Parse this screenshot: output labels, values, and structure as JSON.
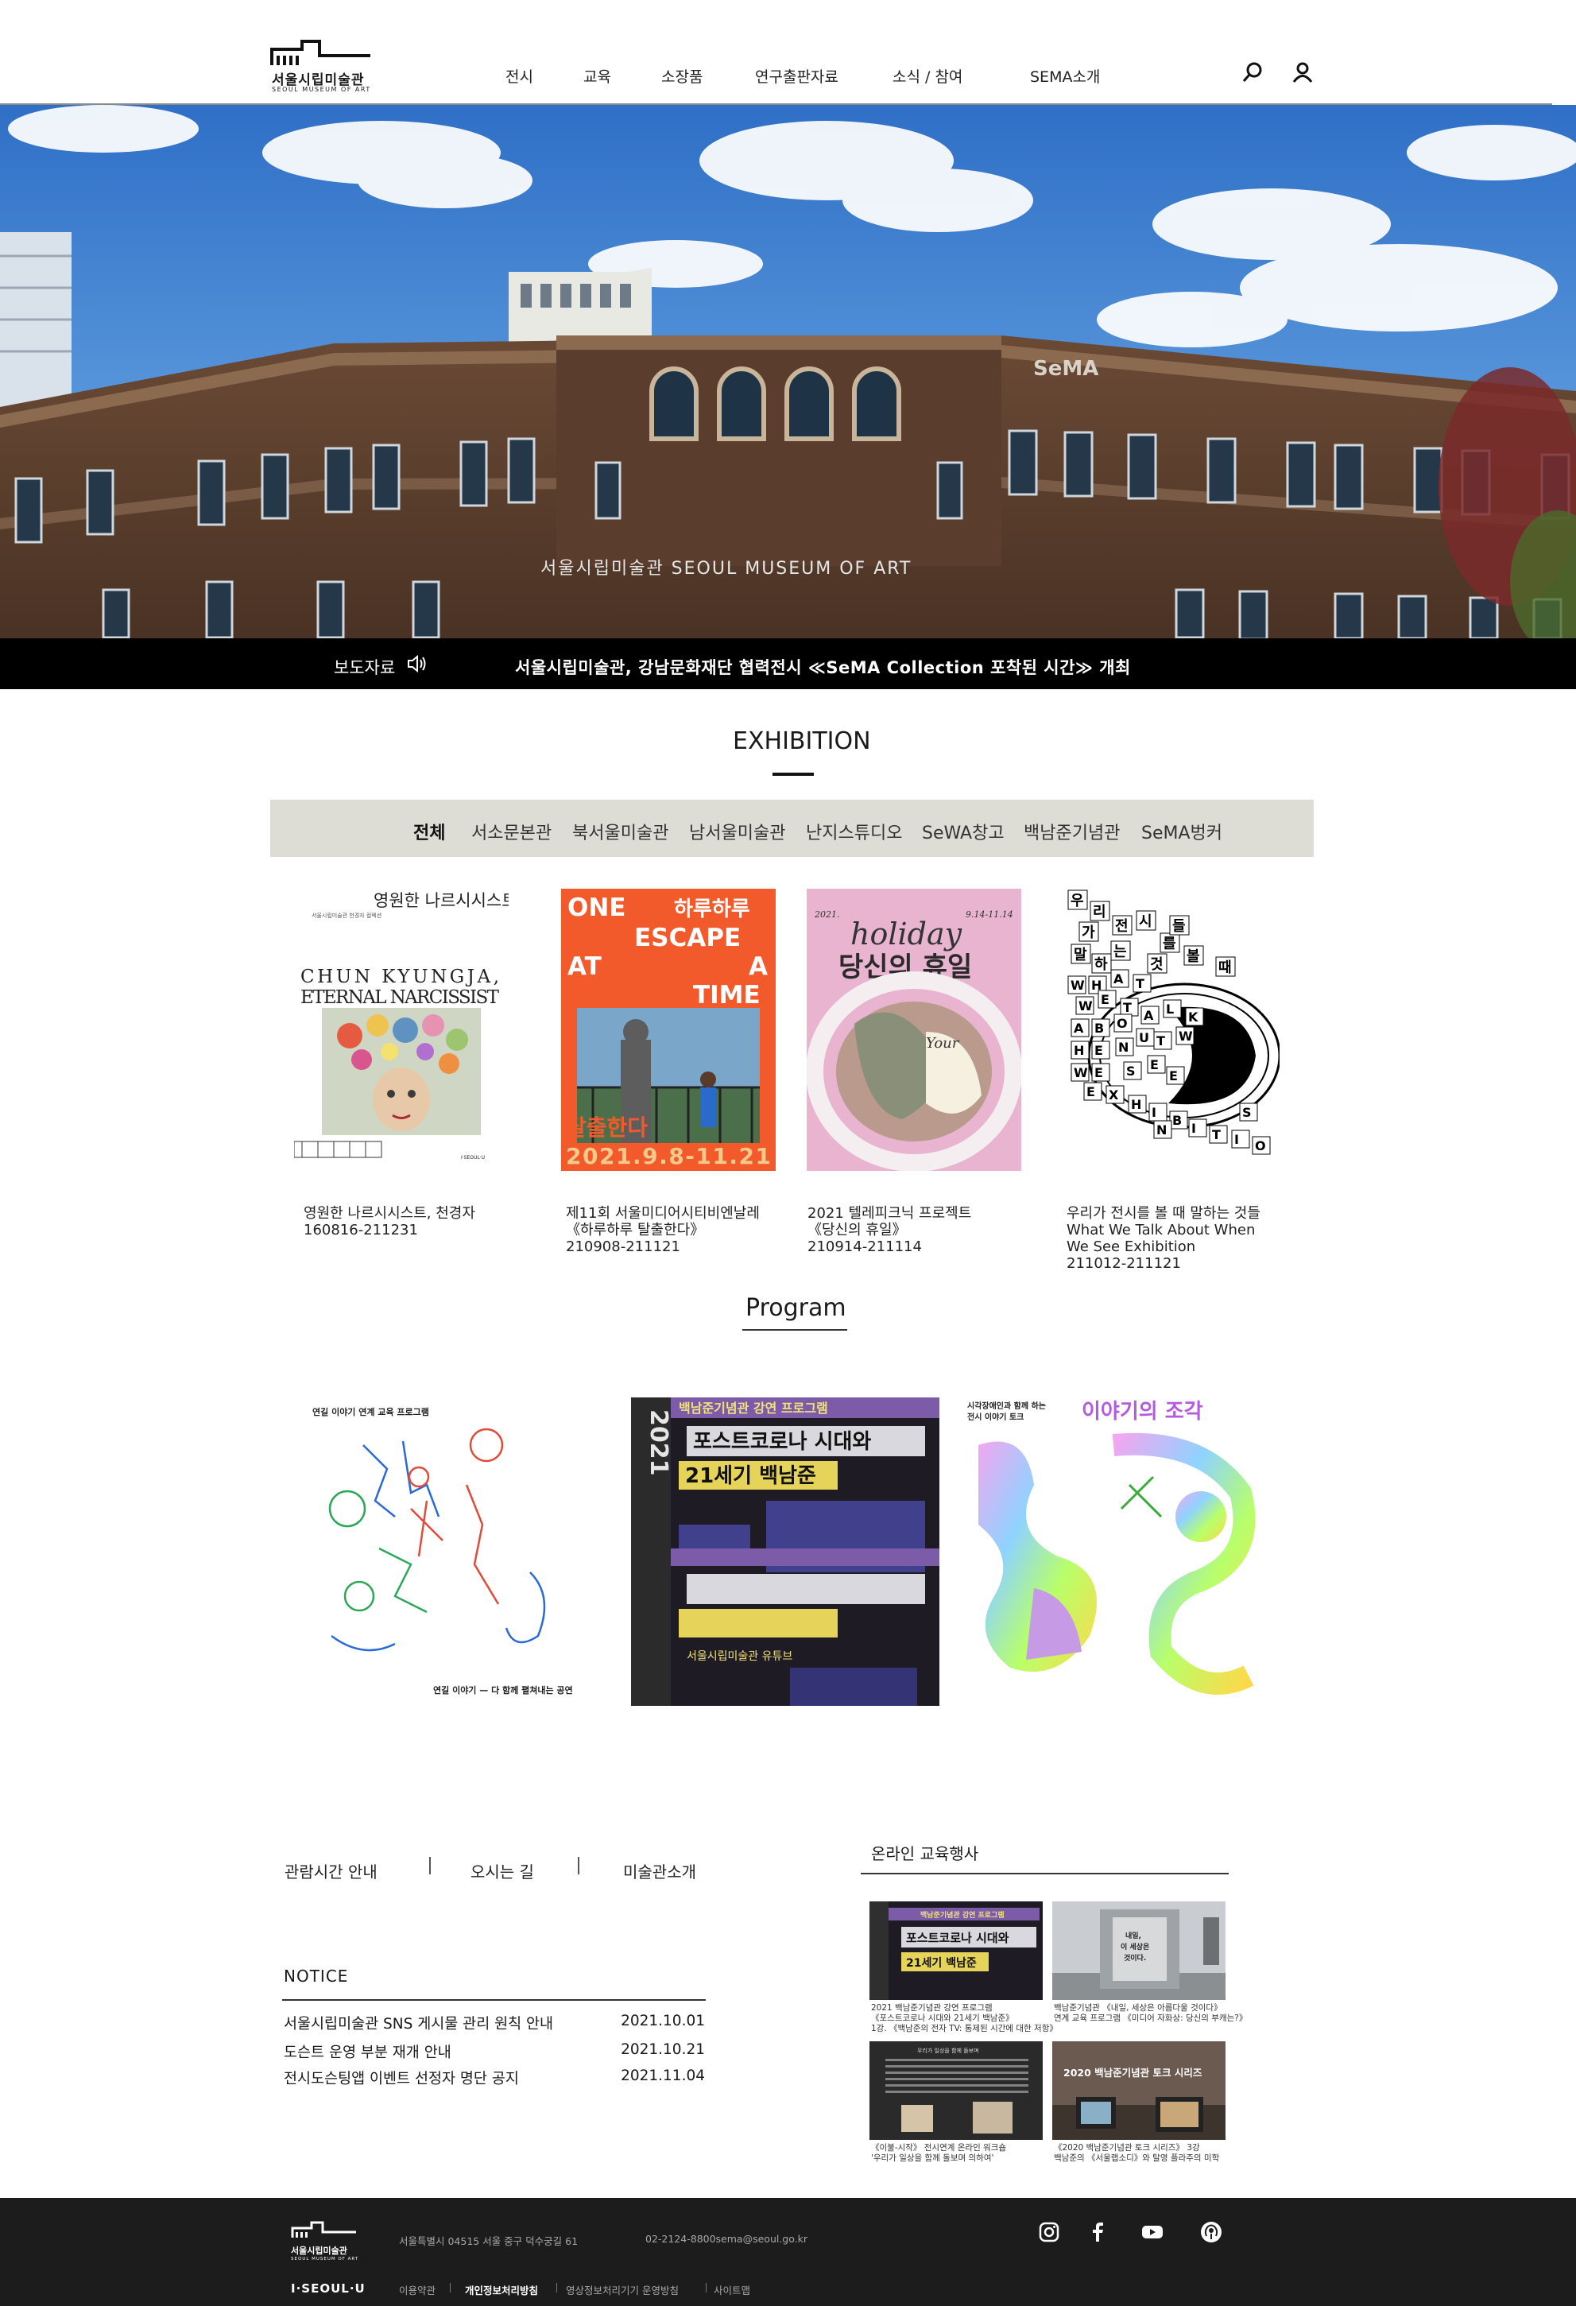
{
  "header": {
    "logo_ko": "서울시립미술관",
    "logo_en": "SEOUL MUSEUM OF ART",
    "nav": [
      "전시",
      "교육",
      "소장품",
      "연구출판자료",
      "소식 / 참여",
      "SEMA소개"
    ],
    "icons": [
      "search-icon",
      "user-icon"
    ]
  },
  "hero": {
    "sign_top": "SeMA",
    "sign_facade": "서울시립미술관 SEOUL MUSEUM OF ART"
  },
  "press": {
    "label": "보도자료",
    "text": "서울시립미술관, 강남문화재단 협력전시 ≪SeMA Collection 포착된 시간≫ 개최"
  },
  "exhibition": {
    "title": "EXHIBITION",
    "tabs": [
      "전체",
      "서소문본관",
      "북서울미술관",
      "남서울미술관",
      "난지스튜디오",
      "SeWA창고",
      "백남준기념관",
      "SeMA벙커"
    ],
    "items": [
      {
        "poster": {
          "small": "서울시립미술관 천경자 컬렉션",
          "title_ko": "영원한 나르시시스트, 천경자",
          "title_en_1": "CHUN KYUNGJA,",
          "title_en_2": "ETERNAL NARCISSIST",
          "logo": "I·SEOUL·U"
        },
        "caption": [
          "영원한 나르시시스트, 천경자",
          "160816-211231"
        ]
      },
      {
        "poster": {
          "word1": "ONE",
          "word2": "하루하루",
          "word3": "ESCAPE",
          "word4": "AT",
          "word5": "A",
          "word6": "TIME",
          "word7": "탈출한다",
          "dates": "2021.9.8-11.21"
        },
        "caption": [
          "제11회 서울미디어시티비엔날레",
          "《하루하루 탈출한다》",
          "210908-211121"
        ]
      },
      {
        "poster": {
          "year": "2021.",
          "range": "9.14-11.14",
          "title_en": "holiday",
          "title_ko": "당신의 휴일",
          "title_en2": "Your"
        },
        "caption": [
          "2021 텔레피크닉 프로젝트",
          "《당신의 휴일》",
          "210914-211114"
        ]
      },
      {
        "poster": {
          "ko_letters": [
            "우",
            "리",
            "가",
            "전",
            "시",
            "를",
            "볼",
            "때",
            "말",
            "하",
            "는",
            "것",
            "들"
          ],
          "en_letters": [
            "W",
            "H",
            "A",
            "T",
            "W",
            "E",
            "T",
            "A",
            "L",
            "K",
            "A",
            "B",
            "O",
            "U",
            "T",
            "W",
            "H",
            "E",
            "N",
            "W",
            "E",
            "S",
            "E",
            "E",
            "E",
            "X",
            "H",
            "I",
            "B",
            "I",
            "T",
            "I",
            "O",
            "N",
            "S"
          ]
        },
        "caption": [
          "우리가 전시를 볼 때 말하는 것들",
          "What We Talk About When",
          "We See Exhibition",
          "211012-211121"
        ]
      }
    ]
  },
  "program": {
    "title": "Program",
    "items": [
      {
        "top": "연길 이야기 연계 교육 프로그램",
        "bottom": "연길 이야기 — 다 함께 펼쳐내는 공연"
      },
      {
        "head": "백남준기념관 강연 프로그램",
        "year": "2021",
        "title1": "포스트코로나 시대와",
        "title2": "21세기 백남준",
        "sub": "서울시립미술관 유튜브"
      },
      {
        "top_1": "시각장애인과 함께 하는",
        "top_2": "전시 이야기 토크",
        "title": "이야기의 조각"
      }
    ]
  },
  "quick_links": [
    "관람시간 안내",
    "오시는 길",
    "미술관소개"
  ],
  "notice": {
    "title": "NOTICE",
    "items": [
      {
        "title": "서울시립미술관 SNS 게시물 관리 원칙 안내",
        "date": "2021.10.01"
      },
      {
        "title": "도슨트 운영 부분 재개 안내",
        "date": "2021.10.21"
      },
      {
        "title": "전시도슨팅앱 이벤트 선정자 명단 공지",
        "date": "2021.11.04"
      }
    ]
  },
  "online": {
    "title": "온라인 교육행사",
    "items": [
      {
        "thumb_1": "백남준기념관 강연 프로그램",
        "thumb_2": "포스트코로나 시대와",
        "thumb_3": "21세기 백남준",
        "caption": [
          "2021 백남준기념관 강연 프로그램",
          "《포스트코로나 시대와 21세기 백남준》",
          "1강. 《백남준의 전자 TV: 통제된 시간에 대한 저항》"
        ]
      },
      {
        "thumb_1": "내일,",
        "thumb_2": "이 세상은",
        "thumb_3": "것이다.",
        "caption": [
          "백남준기념관 《내일, 세상은 아름다울 것이다》",
          "연계 교육 프로그램 《미디어 자화상: 당신의 부캐는?》"
        ]
      },
      {
        "thumb_1": "우리가 일상을 함께 돌보며",
        "caption": [
          "《이불-시작》 전시연계 온라인 워크숍",
          "'우리가 일상을 함께 돌보며 의하여'"
        ]
      },
      {
        "thumb_1": "2020 백남준기념관 토크 시리즈",
        "caption": [
          "《2020 백남준기념관 토크 시리즈》 3강",
          "백남준의 《서울랩소디》와 탈영 플라주의 미학"
        ]
      }
    ]
  },
  "footer": {
    "logo_ko": "서울시립미술관",
    "logo_en": "SEOUL MUSEUM OF ART",
    "iseoul": "I·SEOUL·U",
    "address": "서울특별시 04515 서울 중구 덕수궁길 61",
    "contact": "02-2124-8800sema@seoul.go.kr",
    "links": [
      "이용약관",
      "개인정보처리방침",
      "영상정보처리기기 운영방침",
      "사이트맵"
    ],
    "sns": [
      "instagram-icon",
      "facebook-icon",
      "youtube-icon",
      "podcast-icon"
    ]
  },
  "colors": {
    "accent_orange": "#f25a2c",
    "press_bar": "#000000",
    "tab_bar": "#deddd5",
    "footer": "#1c1c1c"
  }
}
